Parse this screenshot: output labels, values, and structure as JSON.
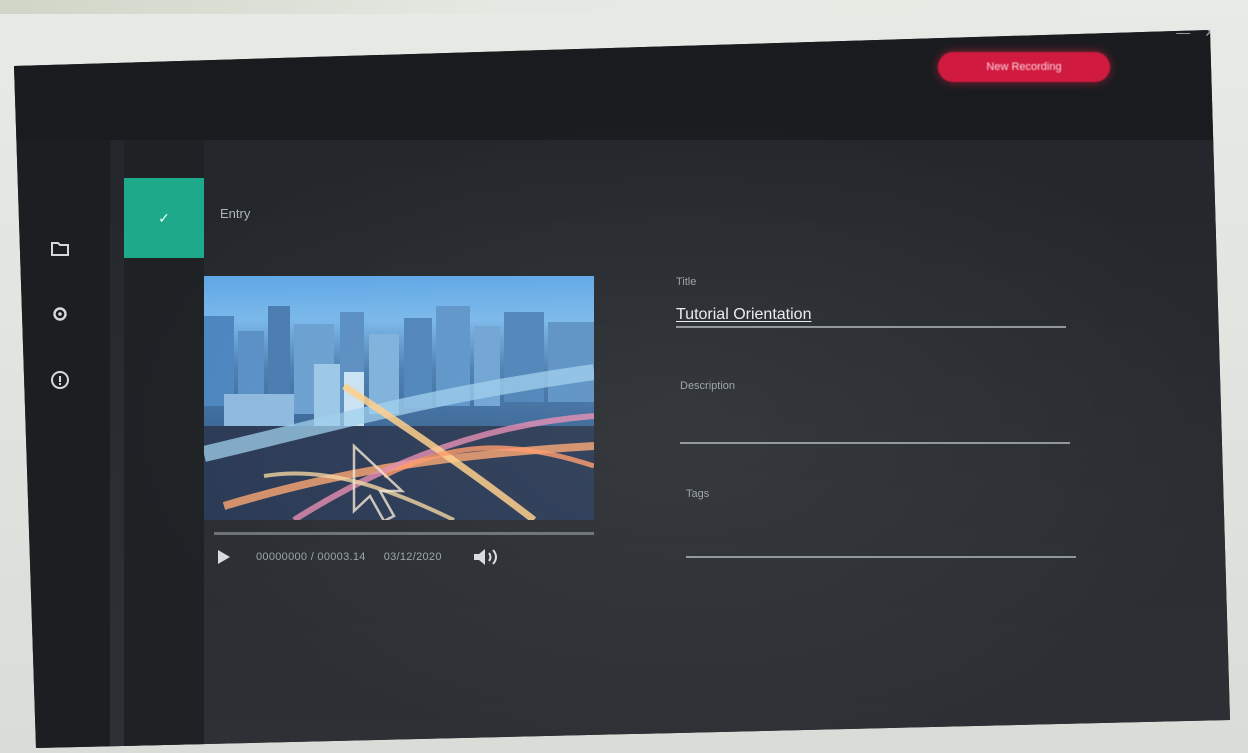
{
  "window": {
    "minimize_glyph": "—",
    "close_glyph": "✕"
  },
  "header": {
    "record_button_label": "New Recording"
  },
  "sidebar": {
    "items": [
      {
        "icon": "folder-icon"
      },
      {
        "icon": "gear-icon"
      },
      {
        "icon": "info-icon"
      }
    ]
  },
  "entry": {
    "badge_glyph": "✓",
    "title": "Entry"
  },
  "player": {
    "timecode": "00000000 / 00003.14",
    "date": "03/12/2020",
    "progress": 0.0
  },
  "form": {
    "title_label": "Title",
    "title_value": "Tutorial Orientation",
    "description_label": "Description",
    "description_value": "",
    "tags_label": "Tags",
    "tags_value": ""
  },
  "colors": {
    "accent_red": "#d11a3f",
    "accent_teal": "#1ea98a",
    "background": "#1f2326"
  }
}
